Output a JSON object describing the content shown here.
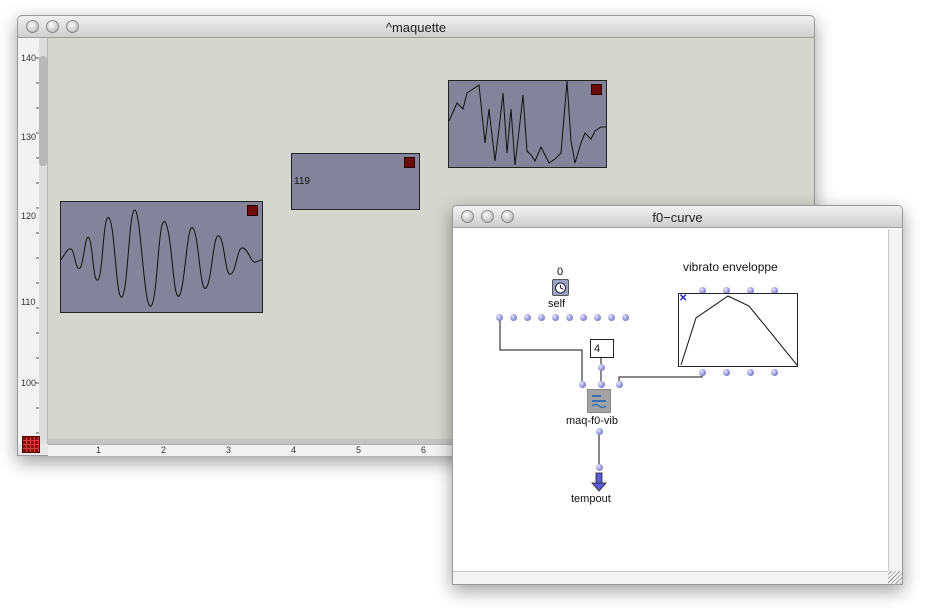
{
  "maquette": {
    "title": "^maquette",
    "y_ticks": [
      "140",
      "130",
      "120",
      "110",
      "100"
    ],
    "x_ticks": [
      "1",
      "2",
      "3",
      "4",
      "5",
      "6"
    ],
    "middle_box_value": "119"
  },
  "f0": {
    "title": "f0−curve",
    "self_value": "0",
    "self_label": "self",
    "number_box_value": "4",
    "function_label": "maq-f0-vib",
    "envelope_title": "vibrato enveloppe",
    "output_label": "tempout"
  },
  "icons": {
    "clock": "clock-icon",
    "function": "function-icon",
    "output": "output-arrow-icon",
    "grid": "grid-icon"
  },
  "colors": {
    "canvas": "#d6d6d0",
    "box_fill": "#858399",
    "mute": "#6b0c0c",
    "inlet": "#7c7ccc"
  }
}
